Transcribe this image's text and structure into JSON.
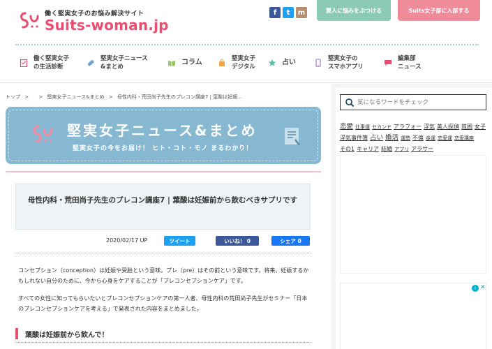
{
  "header": {
    "tagline": "働く堅実女子のお悩み解決サイト",
    "brand_part1": "Suits",
    "brand_dash": "-",
    "brand_part2": "woman.jp",
    "consult_label": "賢人に悩みをぶつける",
    "join_label": "Suits女子部に入部する",
    "social": [
      {
        "name": "facebook",
        "glyph": "f",
        "color": "#3b5998"
      },
      {
        "name": "twitter",
        "glyph": "t",
        "color": "#1da1f2"
      },
      {
        "name": "subscribe",
        "glyph": "m",
        "color": "#b58e6e"
      }
    ]
  },
  "nav": [
    {
      "line1": "働く堅実女子",
      "line2": "の生活診断",
      "icon": "checklist-icon",
      "color": "#e94d70"
    },
    {
      "line1": "堅実女子ニュース",
      "line2": "&まとめ",
      "icon": "pill-icon",
      "color": "#6aa8d4"
    },
    {
      "line1": "コラム",
      "line2": "",
      "icon": "book-icon",
      "color": "#9bc56b"
    },
    {
      "line1": "堅実女子",
      "line2": "デジタル",
      "icon": "bag-icon",
      "color": "#f0a44a"
    },
    {
      "line1": "占い",
      "line2": "",
      "icon": "star-icon",
      "color": "#5cbfa5"
    },
    {
      "line1": "堅実女子の",
      "line2": "スマホアプリ",
      "icon": "phone-icon",
      "color": "#a57cc8"
    },
    {
      "line1": "編集部",
      "line2": "ニュース",
      "icon": "chat-icon",
      "color": "#e94d70"
    }
  ],
  "breadcrumb": [
    "トップ",
    ">",
    ">",
    "堅実女子ニュース&まとめ",
    ">",
    "母性内科・荒田尚子先生のプレコン講座7 | 葉酸は妊娠..."
  ],
  "banner": {
    "title": "堅実女子ニュース&まとめ",
    "subtitle": "堅実女子の今をお届け！ ヒト・コト・モノ まるわかり！"
  },
  "article": {
    "title": "母性内科・荒田尚子先生のプレコン講座7 | 葉酸は妊娠前から飲むべきサプリです",
    "date": "2020/02/17 UP",
    "tweet_label": "ツイート",
    "like_label": "いいね！ 0",
    "share_label": "シェア 0",
    "para1": "コンセプション（conception）は妊娠や受胎という意味。プレ（pre）はその前という意味です。将来、妊娠するかもしれない自分のために、今から心身をケアすることが「プレコンセプションケア」です。",
    "para2": "すべての女性に知ってもらいたいとプレコンセプションケアの第一人者、母性内科の荒田尚子先生がセミナー「日本のプレコンセプションケアを考える」で発表された内容をまとめました。",
    "section_heading": "葉酸は妊娠前から飲んで！"
  },
  "sidebar": {
    "search_placeholder": "気になるワードをチェック",
    "tags": [
      {
        "text": "恋愛",
        "size": "lg"
      },
      {
        "text": "仕事運",
        "size": "sm"
      },
      {
        "text": "セカンド",
        "size": "sm"
      },
      {
        "text": "アラフォー",
        "size": "md"
      },
      {
        "text": "浮気",
        "size": "md"
      },
      {
        "text": "美人探偵",
        "size": "md"
      },
      {
        "text": "貧困",
        "size": "md"
      },
      {
        "text": "女子",
        "size": "md"
      },
      {
        "text": "浮気事件簿",
        "size": "md"
      },
      {
        "text": "占い",
        "size": "lg"
      },
      {
        "text": "婚活",
        "size": "lg"
      },
      {
        "text": "運勢",
        "size": "sm"
      },
      {
        "text": "不倫",
        "size": "md"
      },
      {
        "text": "金運",
        "size": "sm"
      },
      {
        "text": "恋愛運",
        "size": "sm"
      },
      {
        "text": "恋愛講座",
        "size": "sm"
      },
      {
        "text": "その1",
        "size": "md"
      },
      {
        "text": "キャリア",
        "size": "md"
      },
      {
        "text": "結婚",
        "size": "md"
      },
      {
        "text": "アプリ",
        "size": "sm"
      },
      {
        "text": "アラサー",
        "size": "md"
      }
    ],
    "ad_badge": "i",
    "ad_close": "✕"
  }
}
